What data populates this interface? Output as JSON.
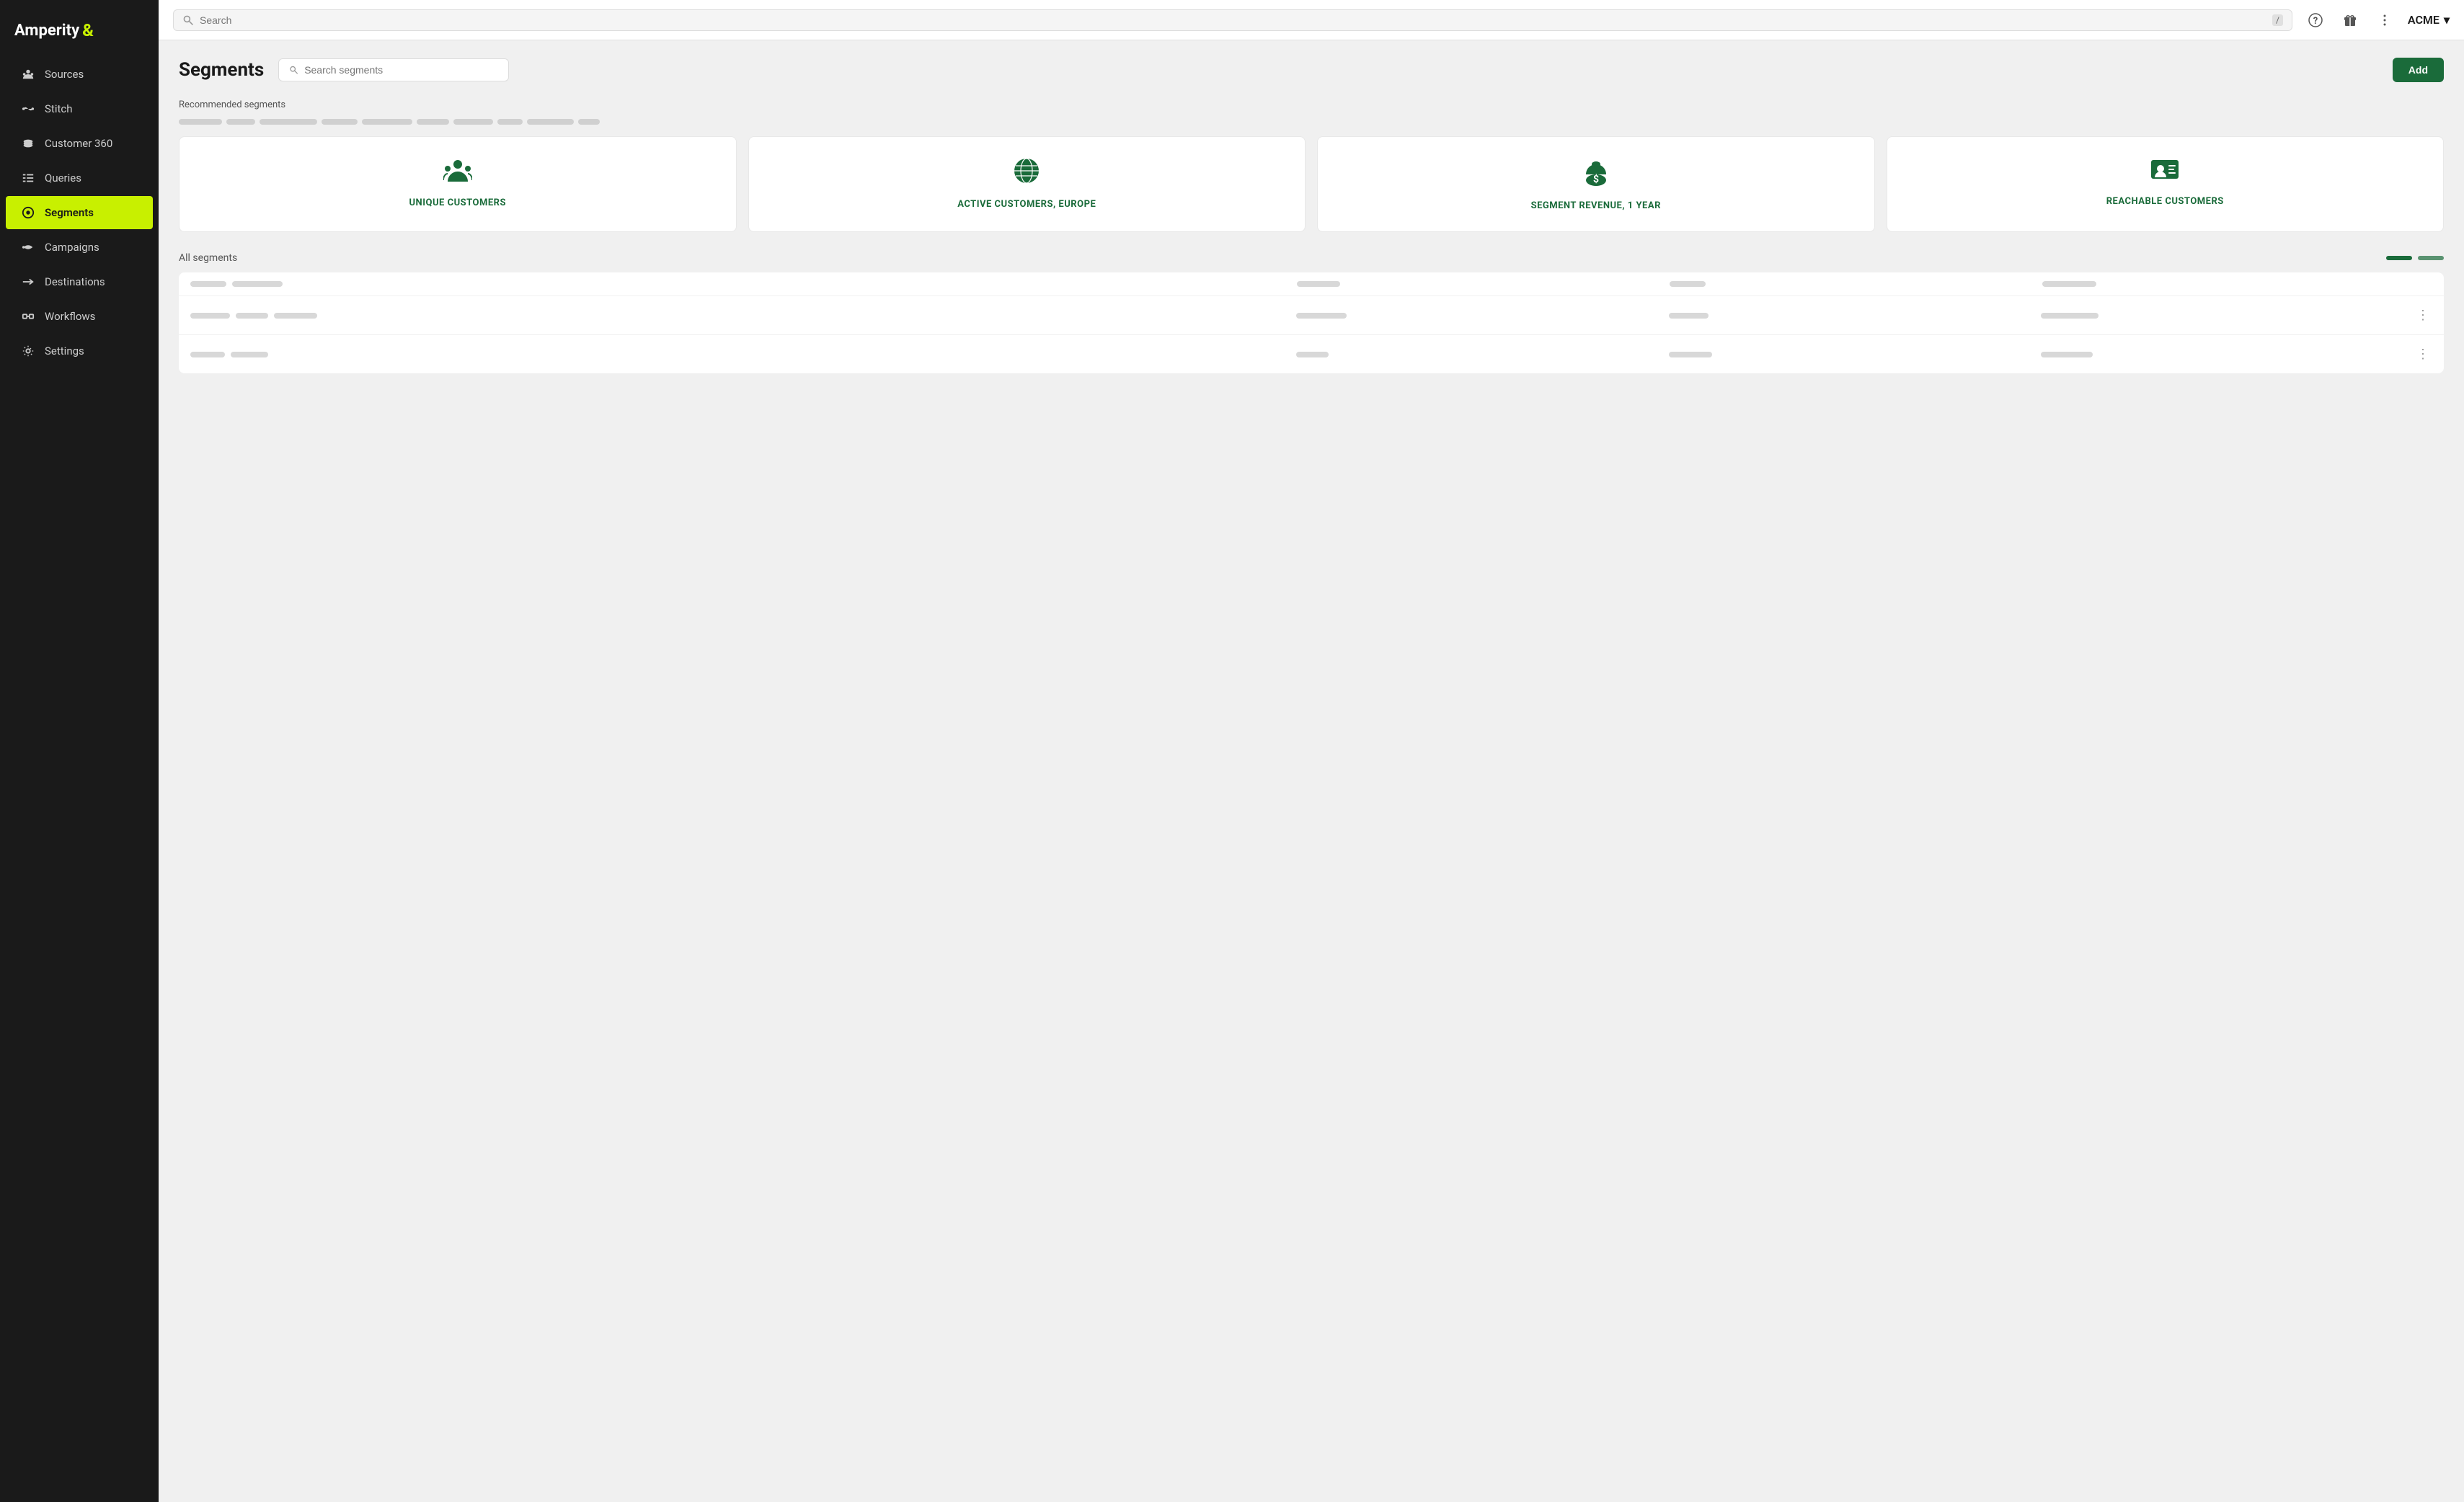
{
  "app": {
    "name": "Amperity",
    "symbol": "&"
  },
  "topbar": {
    "search_placeholder": "Search",
    "slash_shortcut": "/",
    "user_name": "ACME",
    "chevron": "▾"
  },
  "sidebar": {
    "items": [
      {
        "id": "sources",
        "label": "Sources",
        "icon": "sources",
        "active": false
      },
      {
        "id": "stitch",
        "label": "Stitch",
        "icon": "stitch",
        "active": false
      },
      {
        "id": "customer360",
        "label": "Customer 360",
        "icon": "customer360",
        "active": false
      },
      {
        "id": "queries",
        "label": "Queries",
        "icon": "queries",
        "active": false
      },
      {
        "id": "segments",
        "label": "Segments",
        "icon": "segments",
        "active": true
      },
      {
        "id": "campaigns",
        "label": "Campaigns",
        "icon": "campaigns",
        "active": false
      },
      {
        "id": "destinations",
        "label": "Destinations",
        "icon": "destinations",
        "active": false
      },
      {
        "id": "workflows",
        "label": "Workflows",
        "icon": "workflows",
        "active": false
      },
      {
        "id": "settings",
        "label": "Settings",
        "icon": "settings",
        "active": false
      }
    ]
  },
  "page": {
    "title": "Segments",
    "search_placeholder": "Search segments",
    "add_label": "Add",
    "recommended_label": "Recommended segments",
    "all_segments_label": "All segments"
  },
  "recommended_cards": [
    {
      "id": "unique",
      "label": "UNIQUE CUSTOMERS",
      "icon": "users"
    },
    {
      "id": "active_europe",
      "label": "ACTIVE CUSTOMERS, EUROPE",
      "icon": "globe"
    },
    {
      "id": "segment_revenue",
      "label": "SEGMENT REVENUE, 1 YEAR",
      "icon": "money"
    },
    {
      "id": "reachable",
      "label": "REACHABLE CUSTOMERS",
      "icon": "contact"
    }
  ],
  "table_rows": [
    {
      "id": 1,
      "has_menu": false
    },
    {
      "id": 2,
      "has_menu": true
    },
    {
      "id": 3,
      "has_menu": true
    }
  ]
}
